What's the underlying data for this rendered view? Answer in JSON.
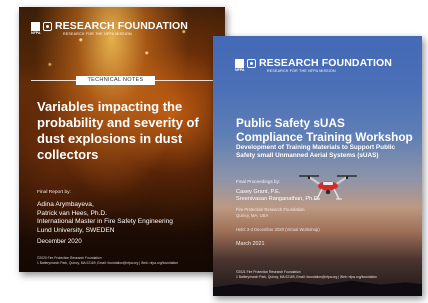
{
  "cover_left": {
    "org_name": "RESEARCH FOUNDATION",
    "tagline": "RESEARCH FOR THE NFPA MISSION",
    "nfpa_mark": "NFPA",
    "badge": "TECHNICAL NOTES",
    "title_lines": [
      "Variables impacting the",
      "probability and severity of",
      "dust explosions in dust",
      "collectors"
    ],
    "final_report_label": "Final Report by:",
    "authors": [
      "Adina Arymbayeva,",
      "Patrick van Hees, Ph.D."
    ],
    "affiliation": [
      "International Master in Fire Safety Engineering",
      "Lund University, SWEDEN"
    ],
    "date": "December 2020",
    "footer": [
      "©2020 Fire Protection Research Foundation",
      "1 Batterymarch Park, Quincy, MA 02169, Email: foundation@nfpa.org | Web: nfpa.org/foundation"
    ]
  },
  "cover_right": {
    "org_name": "RESEARCH FOUNDATION",
    "tagline": "RESEARCH FOR THE NFPA MISSION",
    "nfpa_mark": "NFPA",
    "title_lines": [
      "Public Safety sUAS",
      "Compliance Training Workshop"
    ],
    "subtitle_lines": [
      "Development of Training Materials to Support Public",
      "Safety small Unmanned Aerial Systems (sUAS)"
    ],
    "final_proceedings_label": "Final Proceedings by:",
    "authors": [
      "Casey Grant, P.E.",
      "Sreenivasan Ranganathan, Ph.D."
    ],
    "org_lines": [
      "Fire Protection Research Foundation",
      "Quincy, MA, USA"
    ],
    "note": "Held: 2-3 December 2020 (Virtual Workshop)",
    "date": "March 2021",
    "footer": [
      "©2021 Fire Protection Research Foundation",
      "1 Batterymarch Park, Quincy, MA 02169, Email: foundation@nfpa.org | Web: nfpa.org/foundation"
    ]
  },
  "colors": {
    "nfpa_red": "#b1151b",
    "fire_orange": "#e0781e",
    "sky_blue": "#4469b6",
    "drone_red": "#d42a2a"
  }
}
